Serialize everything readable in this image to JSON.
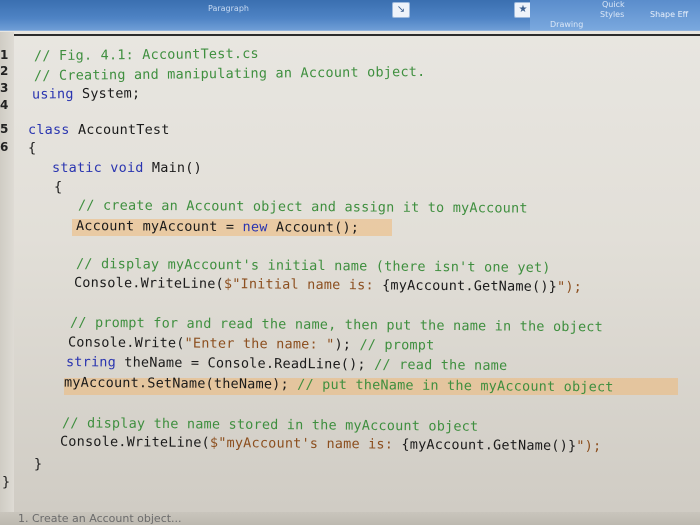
{
  "ribbon": {
    "paragraph_label": "Paragraph",
    "styles_label": "Styles",
    "shape_effects_label": "Shape Eff",
    "drawing_label": "Drawing",
    "quick_label": "Quick"
  },
  "line_numbers": [
    "1",
    "2",
    "3",
    "4",
    "5",
    "6"
  ],
  "code": {
    "l1": "// Fig. 4.1: AccountTest.cs",
    "l2": "// Creating and manipulating an Account object.",
    "l3_kw": "using",
    "l3_rest": " System;",
    "l5_kw": "class",
    "l5_rest": " AccountTest",
    "l6": "{",
    "l7_kw": "static void",
    "l7_rest": " Main()",
    "l8": "{",
    "l9": "// create an Account object and assign it to myAccount",
    "l10_a": "Account myAccount = ",
    "l10_kw": "new",
    "l10_b": " Account();",
    "l12": "// display myAccount's initial name (there isn't one yet)",
    "l13_a": "Console.WriteLine(",
    "l13_str": "$\"Initial name is: ",
    "l13_b": "{myAccount.GetName()}",
    "l13_c": "\");",
    "l15": "// prompt for and read the name, then put the name in the object",
    "l16_a": "Console.Write(",
    "l16_str": "\"Enter the name: \"",
    "l16_b": "); ",
    "l16_cm": "// prompt",
    "l17_kw": "string",
    "l17_a": " theName = Console.ReadLine(); ",
    "l17_cm": "// read the name",
    "l18_a": "myAccount.SetName(theName); ",
    "l18_cm": "// put theName in the myAccount object",
    "l20": "// display the name stored in the myAccount object",
    "l21_a": "Console.WriteLine(",
    "l21_str": "$\"myAccount's name is: ",
    "l21_b": "{myAccount.GetName()}",
    "l21_c": "\");",
    "l22": "}",
    "l23": "}"
  },
  "bottom_text": "1. Create an Account object..."
}
